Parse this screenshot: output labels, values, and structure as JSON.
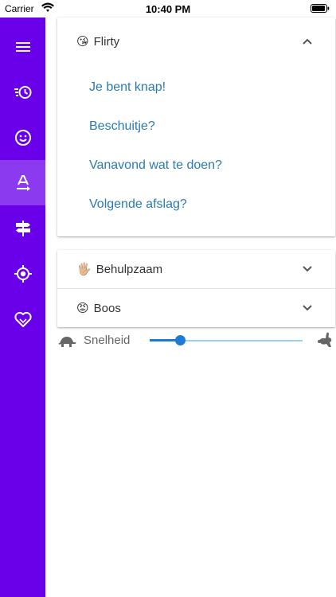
{
  "status_bar": {
    "carrier": "Carrier",
    "time": "10:40 PM"
  },
  "sidebar": {
    "accent": "#6a00ea",
    "active_accent": "#8b3af0",
    "items": [
      {
        "icon": "menu-icon",
        "active": false
      },
      {
        "icon": "history-icon",
        "active": false
      },
      {
        "icon": "smiley-icon",
        "active": false
      },
      {
        "icon": "text-format-icon",
        "active": true
      },
      {
        "icon": "signpost-icon",
        "active": false
      },
      {
        "icon": "location-target-icon",
        "active": false
      },
      {
        "icon": "heart-icon",
        "active": false
      }
    ]
  },
  "categories": [
    {
      "emoji": "😘",
      "title": "Flirty",
      "expanded": true,
      "phrases": [
        "Je bent knap!",
        "Beschuitje?",
        "Vanavond wat te doen?",
        "Volgende afslag?"
      ]
    },
    {
      "emoji": "🖐🏼",
      "title": "Behulpzaam",
      "expanded": false
    },
    {
      "emoji": "😡",
      "title": "Boos",
      "expanded": false
    }
  ],
  "speed": {
    "label": "Snelheid",
    "value": 0.2,
    "left_icon": "turtle-icon",
    "right_icon": "rabbit-icon"
  },
  "colors": {
    "link": "#2a7ab5",
    "slider": "#1e7bd3",
    "slider_track": "#9ad0f2"
  }
}
